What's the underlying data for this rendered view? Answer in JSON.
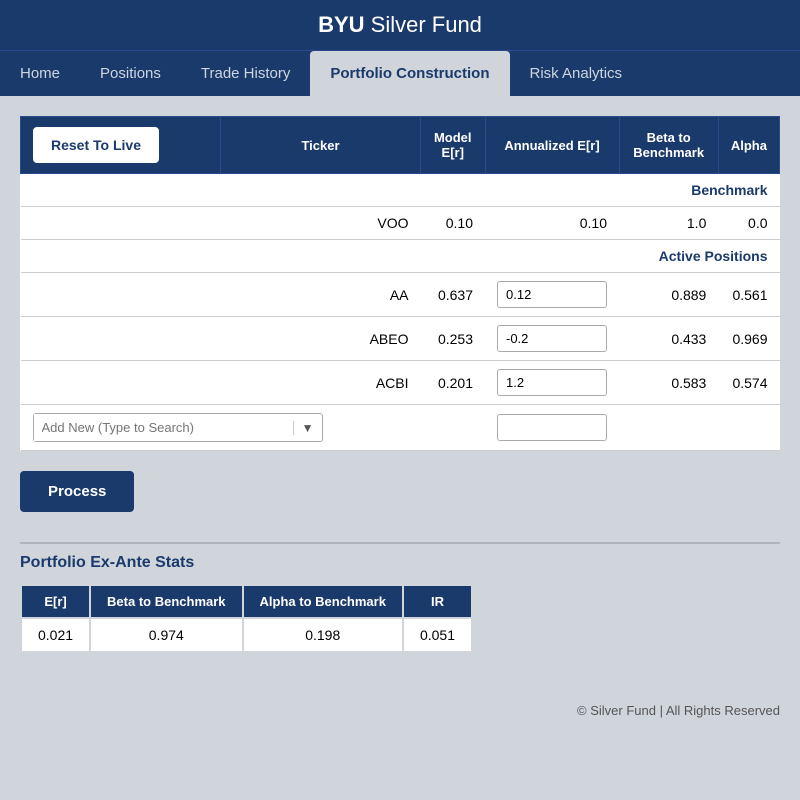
{
  "header": {
    "brand": "BYU",
    "title": " Silver Fund"
  },
  "nav": {
    "items": [
      {
        "label": "Home",
        "active": false
      },
      {
        "label": "Positions",
        "active": false
      },
      {
        "label": "Trade History",
        "active": false
      },
      {
        "label": "Portfolio Construction",
        "active": true
      },
      {
        "label": "Risk Analytics",
        "active": false
      }
    ]
  },
  "table": {
    "reset_button": "Reset To Live",
    "columns": {
      "ticker": "Ticker",
      "model_er": "Model E[r]",
      "annualized_er": "Annualized E[r]",
      "beta_to_benchmark": "Beta to Benchmark",
      "alpha": "Alpha"
    },
    "benchmark_label": "Benchmark",
    "benchmark_row": {
      "ticker": "VOO",
      "model_er": "0.10",
      "annualized_er": "0.10",
      "beta": "1.0",
      "alpha": "0.0"
    },
    "active_label": "Active Positions",
    "active_rows": [
      {
        "ticker": "AA",
        "model_er": "0.637",
        "annualized_er": "0.12",
        "beta": "0.889",
        "alpha": "0.561"
      },
      {
        "ticker": "ABEO",
        "model_er": "0.253",
        "annualized_er": "-0.2",
        "beta": "0.433",
        "alpha": "0.969"
      },
      {
        "ticker": "ACBI",
        "model_er": "0.201",
        "annualized_er": "1.2",
        "beta": "0.583",
        "alpha": "0.574"
      }
    ],
    "add_new_placeholder": "Add New (Type to Search)"
  },
  "process_button": "Process",
  "stats": {
    "title": "Portfolio Ex-Ante Stats",
    "columns": [
      "E[r]",
      "Beta to Benchmark",
      "Alpha to Benchmark",
      "IR"
    ],
    "values": {
      "er": "0.021",
      "beta": "0.974",
      "alpha": "0.198",
      "ir": "0.051"
    }
  },
  "footer": "© Silver Fund | All Rights Reserved"
}
